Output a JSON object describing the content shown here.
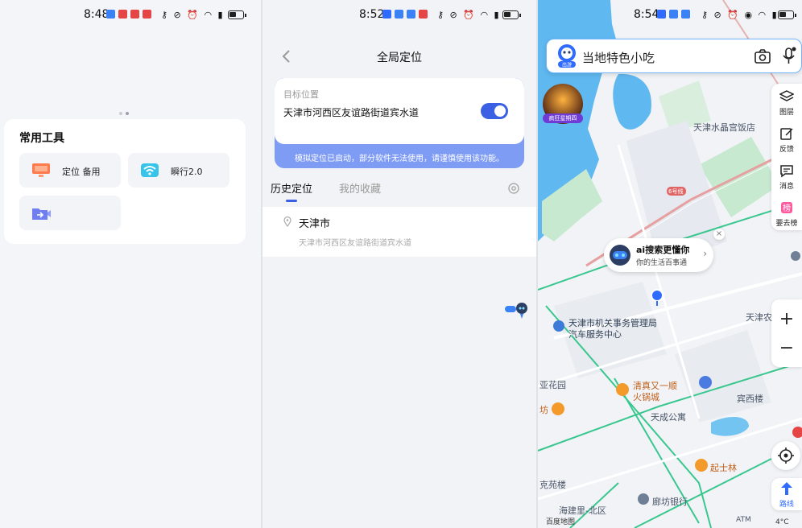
{
  "panel1": {
    "time": "8:48",
    "tools_title": "常用工具",
    "tools": [
      {
        "label": "定位 备用",
        "icon": "monitor-icon"
      },
      {
        "label": "瞬行2.0",
        "icon": "wifi-icon"
      },
      {
        "label": "",
        "icon": "video-folder-icon"
      }
    ]
  },
  "panel2": {
    "time": "8:52",
    "title": "全局定位",
    "target_label": "目标位置",
    "target_address": "天津市河西区友谊路街道宾水道",
    "toggle_on": true,
    "warning": "模拟定位已启动，部分软件无法使用，请谨慎使用该功能。",
    "tabs": [
      "历史定位",
      "我的收藏"
    ],
    "history": [
      {
        "city": "天津市",
        "address": "天津市河西区友谊路街道宾水道"
      }
    ]
  },
  "panel3": {
    "time": "8:54",
    "search_placeholder": "当地特色小吃",
    "search_badge": "出游",
    "promo_label": "疯狂星期四",
    "right_bar": [
      "图层",
      "反馈",
      "消息",
      "要去榜"
    ],
    "route_label": "路线",
    "ai_bubble": {
      "title": "ai搜索更懂你",
      "subtitle": "你的生活百事通"
    },
    "road_badge": "6号线",
    "map_labels": [
      "天津水晶宫饭店",
      "天津市机关事务管理局",
      "汽车服务中心",
      "亚花园",
      "清真又一顺",
      "火锅城",
      "天成公寓",
      "宾西楼",
      "起士林",
      "天津农",
      "坊",
      "克苑楼",
      "海建里-北区",
      "廊坊银行",
      "ATM"
    ],
    "map_attribution": "百度地图",
    "temperature": "4°C"
  },
  "colors": {
    "accent": "#3b60e4",
    "warning_bar": "#7f9cf5",
    "water": "#5fb8f0",
    "park": "#bfe6c6",
    "road_green": "#3ac78f"
  }
}
